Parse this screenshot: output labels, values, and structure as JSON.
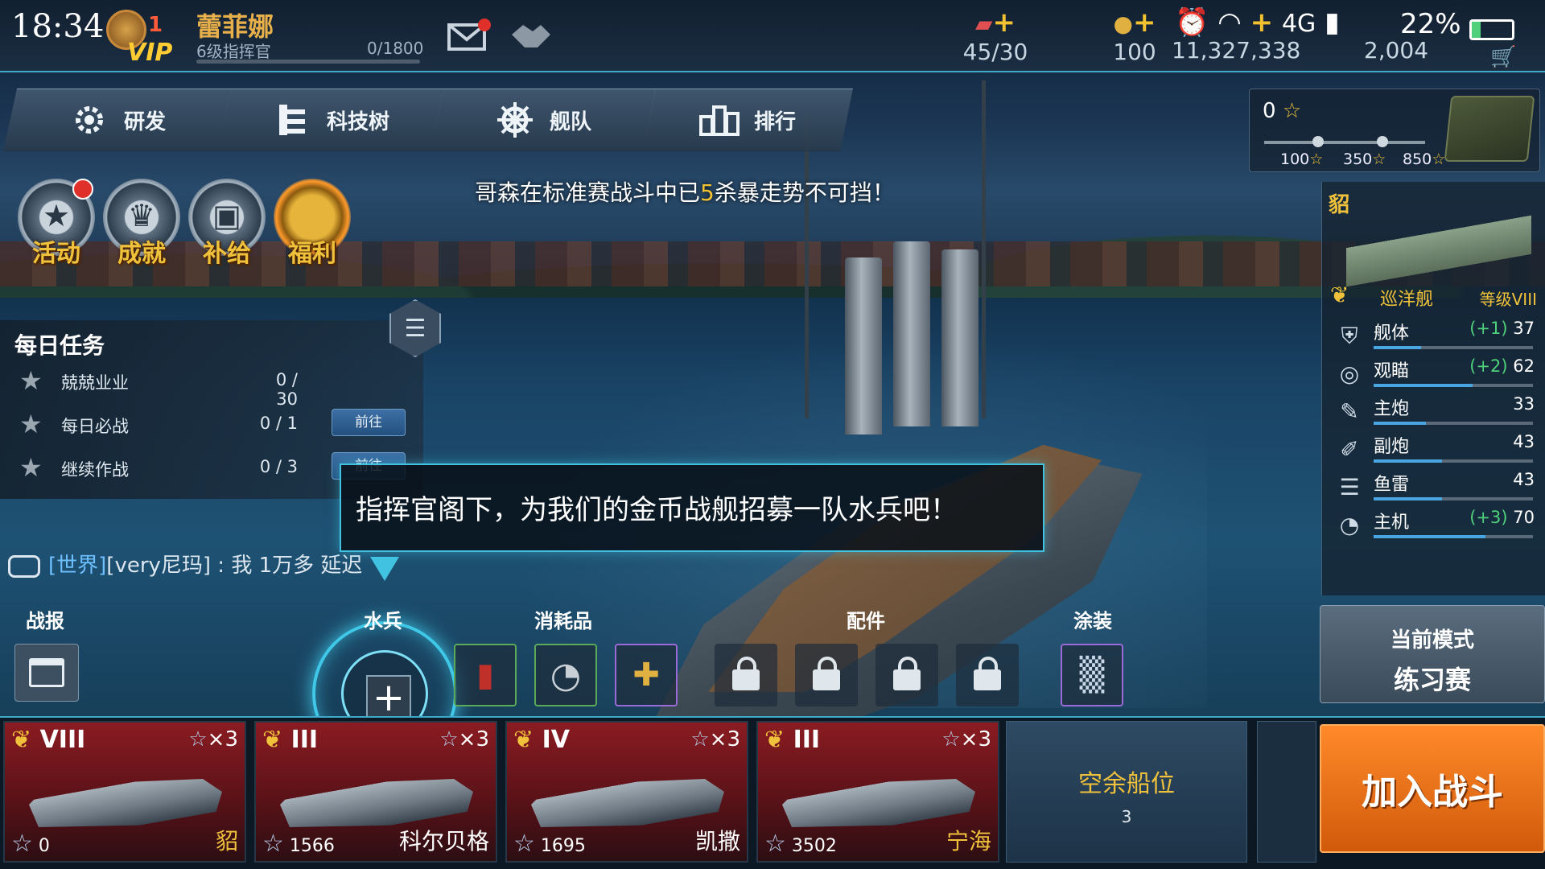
{
  "status": {
    "time": "18:34",
    "battery": "22%",
    "network": "4G"
  },
  "player": {
    "name": "蕾菲娜",
    "rank": "6级指挥官",
    "exp": "0/1800",
    "vip_level": "1",
    "vip_label": "VIP"
  },
  "resources": [
    {
      "icon": "ticket-icon",
      "value": "45/30"
    },
    {
      "icon": "coin-icon",
      "value": "100"
    },
    {
      "icon": "silver-icon",
      "value": "11,327,338"
    },
    {
      "icon": "star-icon",
      "value": "2,004"
    }
  ],
  "nav": {
    "tabs": [
      {
        "label": "研发",
        "icon": "gear-icon"
      },
      {
        "label": "科技树",
        "icon": "tree-icon"
      },
      {
        "label": "舰队",
        "icon": "helm-icon"
      },
      {
        "label": "排行",
        "icon": "ranking-icon"
      }
    ]
  },
  "reward": {
    "current": "0",
    "milestones": [
      "100",
      "350",
      "850"
    ]
  },
  "shortcuts": [
    {
      "label": "活动"
    },
    {
      "label": "成就"
    },
    {
      "label": "补给"
    },
    {
      "label": "福利"
    }
  ],
  "ticker": {
    "pre": "哥森在标准赛战斗中已",
    "num": "5",
    "post": "杀暴走势不可挡！"
  },
  "daily": {
    "title": "每日任务",
    "tasks": [
      {
        "name": "兢兢业业",
        "progress": "0 / 30",
        "button": ""
      },
      {
        "name": "每日必战",
        "progress": "0 / 1",
        "button": "前往"
      },
      {
        "name": "继续作战",
        "progress": "0 / 3",
        "button": "前往"
      }
    ]
  },
  "chat": {
    "channel": "[世界]",
    "text": "[very尼玛] : 我 1万多 延迟"
  },
  "dialog": {
    "text": "指挥官阁下，为我们的金币战舰招募一队水兵吧！"
  },
  "equipment": {
    "report": "战报",
    "crew": "水兵",
    "consumables": "消耗品",
    "parts": "配件",
    "paint": "涂装"
  },
  "ship": {
    "name": "貂",
    "class": "巡洋舰",
    "level": "等级VIII",
    "stats": [
      {
        "name": "舰体",
        "bonus": "(+1)",
        "value": "37",
        "icon": "shield-icon",
        "fill": 0.3
      },
      {
        "name": "观瞄",
        "bonus": "(+2)",
        "value": "62",
        "icon": "scope-icon",
        "fill": 0.62
      },
      {
        "name": "主炮",
        "bonus": "",
        "value": "33",
        "icon": "main-gun-icon",
        "fill": 0.33
      },
      {
        "name": "副炮",
        "bonus": "",
        "value": "43",
        "icon": "secondary-gun-icon",
        "fill": 0.43
      },
      {
        "name": "鱼雷",
        "bonus": "",
        "value": "43",
        "icon": "torpedo-icon",
        "fill": 0.43
      },
      {
        "name": "主机",
        "bonus": "(+3)",
        "value": "70",
        "icon": "engine-icon",
        "fill": 0.7
      }
    ]
  },
  "mode": {
    "label": "当前模式",
    "value": "练习赛"
  },
  "fleet": [
    {
      "tier": "VIII",
      "stars": "×3",
      "points": "0",
      "name": "貂",
      "gold": true
    },
    {
      "tier": "III",
      "stars": "×3",
      "points": "1566",
      "name": "科尔贝格",
      "gold": false
    },
    {
      "tier": "IV",
      "stars": "×3",
      "points": "1695",
      "name": "凯撒",
      "gold": false
    },
    {
      "tier": "III",
      "stars": "×3",
      "points": "3502",
      "name": "宁海",
      "gold": true
    }
  ],
  "empty_slot": {
    "label": "空余船位",
    "count": "3"
  },
  "join_button": "加入战斗",
  "colors": {
    "accent": "#40c2e0",
    "gold": "#f0c23c",
    "join": "#e8721a"
  }
}
